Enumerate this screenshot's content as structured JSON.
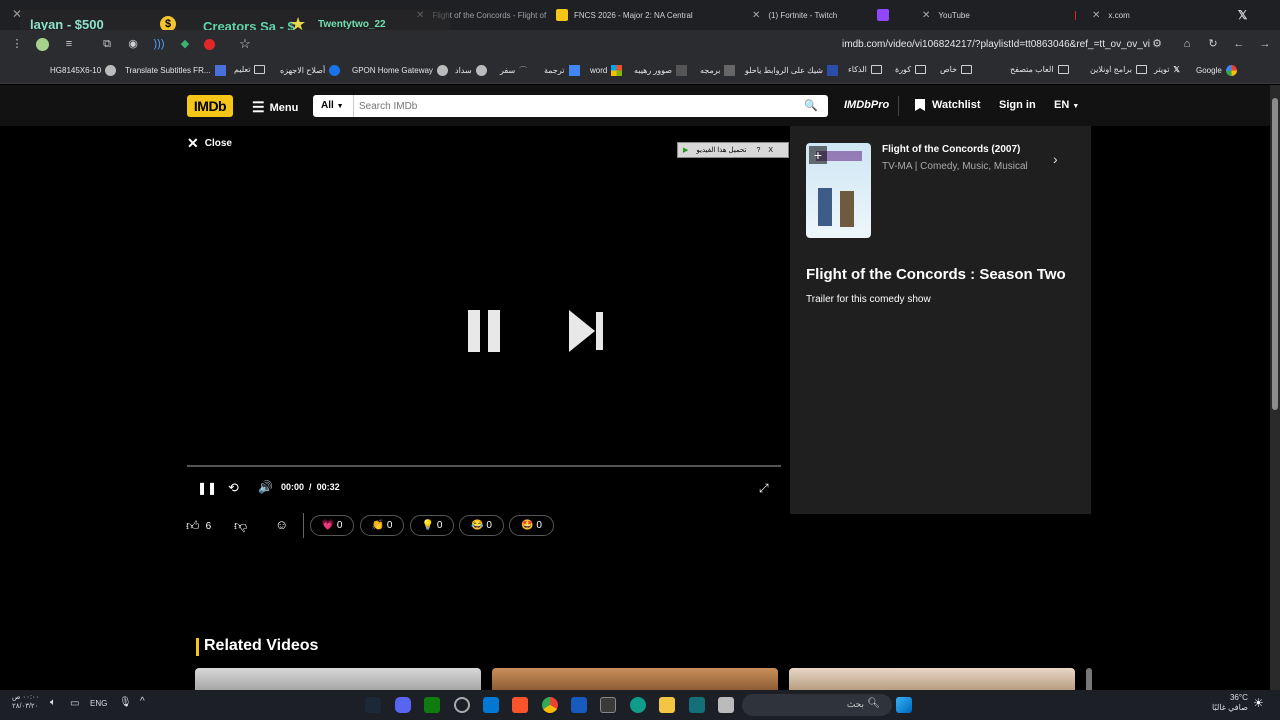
{
  "browser": {
    "tabs": [
      {
        "title": "Flight of the Concords - Flight of",
        "active": true
      },
      {
        "title": "FNCS 2026 - Major 2: NA Central"
      },
      {
        "title": "(1) Fortnite - Twitch"
      },
      {
        "title": "YouTube"
      },
      {
        "title": "x.com"
      }
    ],
    "overlay": {
      "left_text": "layan - $500",
      "mid_text": "Creators Sa - $",
      "right_text": "Twentytwo_22"
    },
    "url": "imdb.com/video/vi106824217/?playlistId=tt0863046&ref_=tt_ov_ov_vi",
    "bookmarks": [
      "Google",
      "تويتر",
      "برامج اونلاين",
      "العاب متصفح",
      "خاص",
      "كورة",
      "الذكاء",
      "شيك على الروابط ياحلو",
      "برمجه",
      "صوور رهيبه",
      "word",
      "ترجمة",
      "سفر",
      "سداد",
      "GPON Home Gateway",
      "أصلاح الاجهزه",
      "تعليم",
      "Translate Subtitles FR...",
      "HG8145X6-10"
    ]
  },
  "imdb": {
    "logo": "IMDb",
    "menu_label": "Menu",
    "search_category": "All",
    "search_placeholder": "Search IMDb",
    "pro_label": "IMDbPro",
    "watchlist_label": "Watchlist",
    "signin_label": "Sign in",
    "lang_label": "EN"
  },
  "player": {
    "close_label": "Close",
    "download_label": "تحميل هذا الفيديو",
    "time_current": "00:00",
    "time_separator": "/",
    "time_total": "00:32",
    "progress": 0.0,
    "likes": "6",
    "reactions": [
      {
        "emoji": "💗",
        "count": "0"
      },
      {
        "emoji": "👏",
        "count": "0"
      },
      {
        "emoji": "💡",
        "count": "0"
      },
      {
        "emoji": "😂",
        "count": "0"
      },
      {
        "emoji": "🤩",
        "count": "0"
      }
    ]
  },
  "side": {
    "title_year": "Flight of the Concords (2007)",
    "meta": "TV-MA | Comedy, Music, Musical",
    "video_title": "Flight of the Concords : Season Two",
    "description": "Trailer for this comedy show"
  },
  "related": {
    "heading": "Related Videos"
  },
  "taskbar": {
    "search_placeholder": "بحث",
    "lang": "ENG",
    "weather_temp": "36°C",
    "weather_desc": "صافي غالبًا",
    "time": "٠٠:٠٠ ص",
    "date": "٢٨/٠٣/٢٠"
  },
  "colors": {
    "imdb_yellow": "#f5c518",
    "bg": "#000000",
    "panel": "#1f1f1f"
  }
}
